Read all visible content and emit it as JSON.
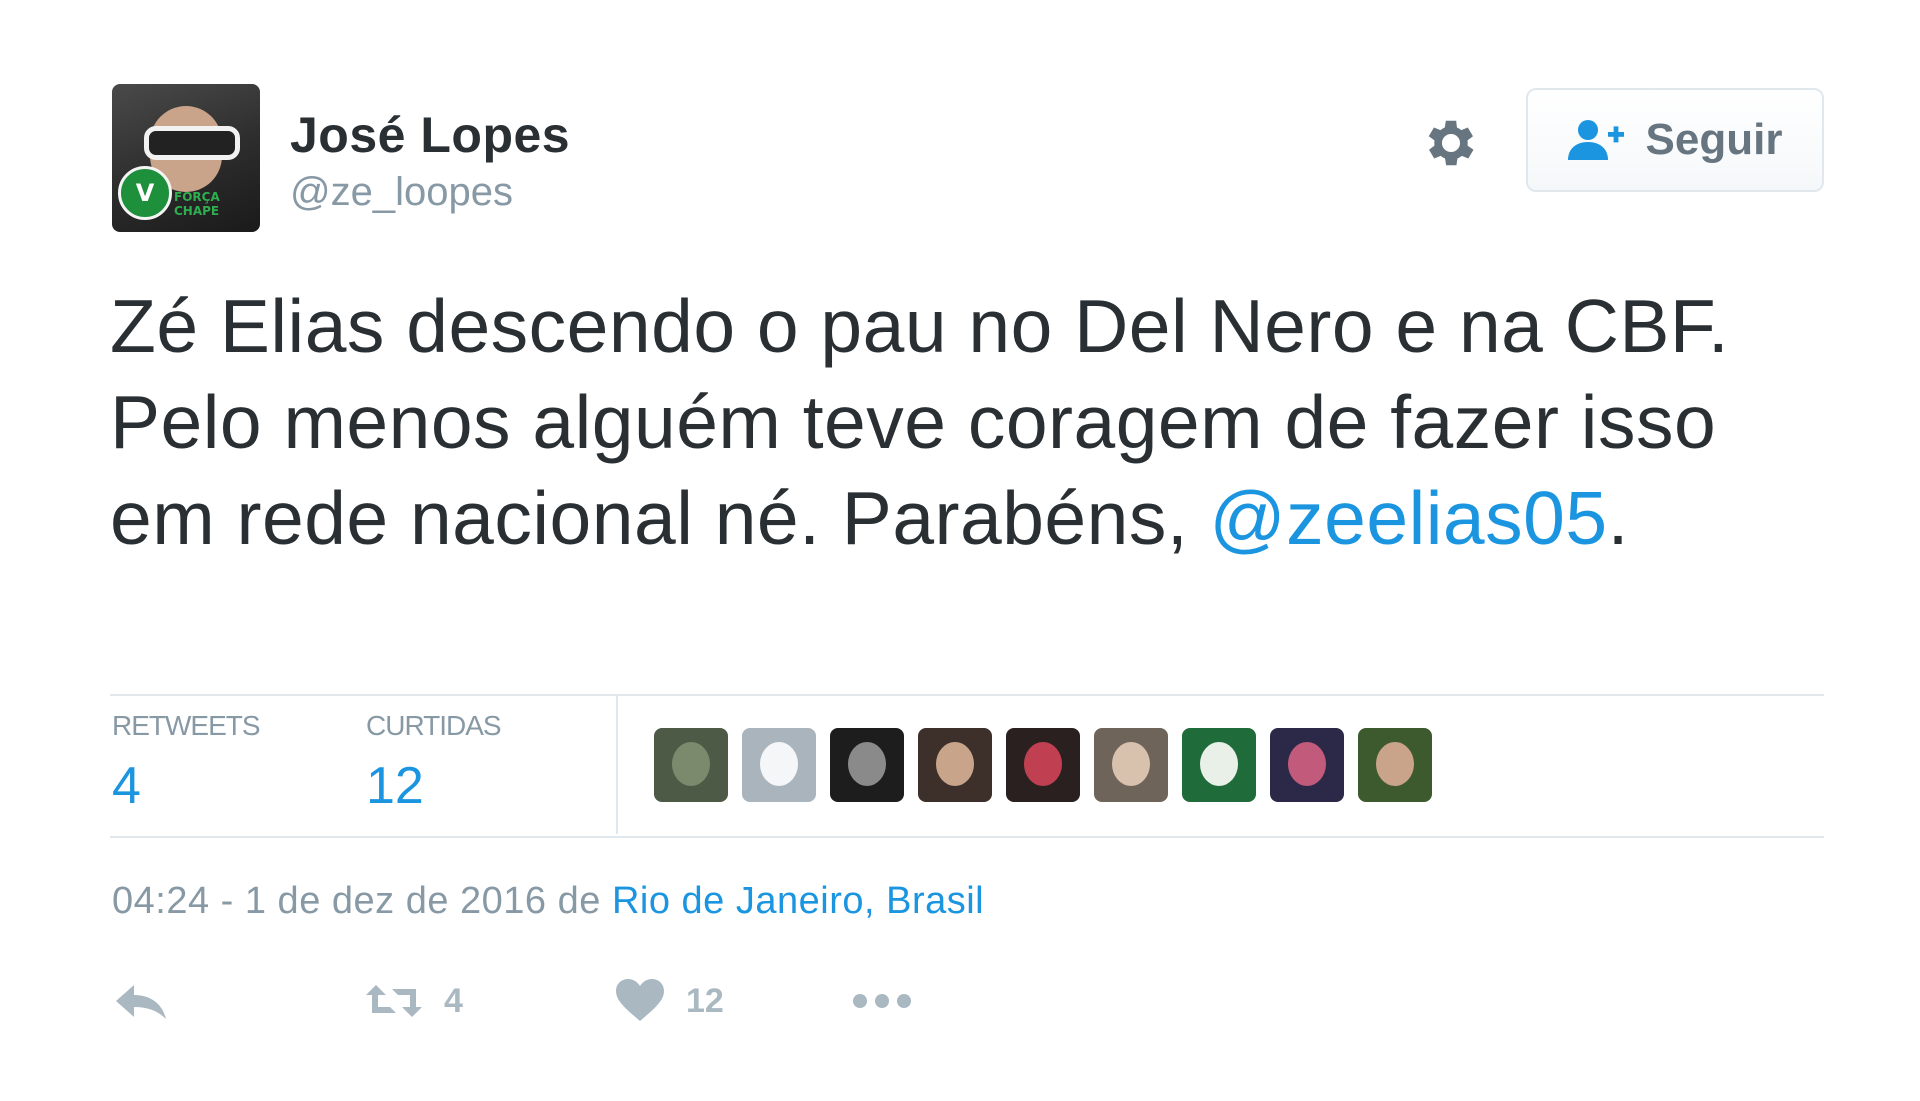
{
  "author": {
    "name": "José Lopes",
    "handle": "@ze_loopes",
    "avatar_badge_text": "FORÇA CHAPE"
  },
  "header": {
    "follow_label": "Seguir"
  },
  "tweet": {
    "text": "Zé Elias descendo o pau no Del Nero e na CBF. Pelo menos alguém teve coragem de fazer isso em rede nacional né. Parabéns, ",
    "mention": "@zeelias05",
    "text_end": "."
  },
  "stats": {
    "retweets_label": "RETWEETS",
    "retweets_value": "4",
    "likes_label": "CURTIDAS",
    "likes_value": "12"
  },
  "likers": [
    {
      "name": "liker-1",
      "bg": "#4d5a46",
      "dot": "#7b8a6d"
    },
    {
      "name": "liker-2",
      "bg": "#a9b4bc",
      "dot": "#f4f6f8"
    },
    {
      "name": "liker-3",
      "bg": "#1d1d1d",
      "dot": "#8a8a8a"
    },
    {
      "name": "liker-4",
      "bg": "#3d2f2a",
      "dot": "#c8a48b"
    },
    {
      "name": "liker-5",
      "bg": "#2a2020",
      "dot": "#c04052"
    },
    {
      "name": "liker-6",
      "bg": "#6f6459",
      "dot": "#d8c2ae"
    },
    {
      "name": "liker-7",
      "bg": "#1f6b3a",
      "dot": "#e8f0e8"
    },
    {
      "name": "liker-8",
      "bg": "#2c2848",
      "dot": "#c25a7b"
    },
    {
      "name": "liker-9",
      "bg": "#3c5a2e",
      "dot": "#c9a38a"
    }
  ],
  "meta": {
    "timestamp": "04:24 - 1 de dez de 2016 de ",
    "place": "Rio de Janeiro, Brasil"
  },
  "actions": {
    "retweet_count": "4",
    "like_count": "12"
  },
  "colors": {
    "accent": "#1b95e0",
    "text": "#292f33",
    "muted": "#8899a6",
    "icon": "#aab8c2"
  },
  "icons": {
    "settings": "gear-icon",
    "follow": "person-add-icon",
    "reply": "reply-icon",
    "retweet": "retweet-icon",
    "like": "heart-icon",
    "more": "more-icon"
  }
}
